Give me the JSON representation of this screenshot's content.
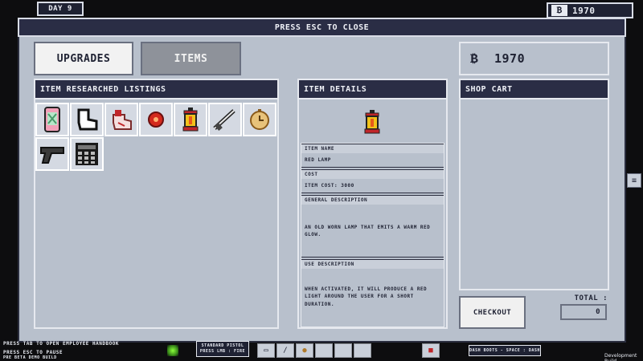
{
  "hud": {
    "day": "DAY 9",
    "money": "1970",
    "currency_symbol": "₿"
  },
  "window": {
    "close_hint": "PRESS ESC TO CLOSE"
  },
  "tabs": [
    {
      "label": "UPGRADES",
      "active": true
    },
    {
      "label": "ITEMS",
      "active": false
    }
  ],
  "wallet": {
    "amount": "1970",
    "symbol": "₿"
  },
  "listings": {
    "title": "ITEM RESEARCHED LISTINGS",
    "items": [
      {
        "icon": "energy-can-icon"
      },
      {
        "icon": "sock-icon"
      },
      {
        "icon": "bandage-icon"
      },
      {
        "icon": "red-orb-icon"
      },
      {
        "icon": "red-lamp-icon"
      },
      {
        "icon": "rifle-icon"
      },
      {
        "icon": "pocket-watch-icon"
      },
      {
        "icon": "pistol-icon"
      },
      {
        "icon": "keypad-icon"
      }
    ]
  },
  "details": {
    "title": "ITEM DETAILS",
    "icon": "red-lamp-icon",
    "name_label": "ITEM NAME",
    "name_value": "RED LAMP",
    "cost_label": "COST",
    "cost_value": "ITEM COST: 3000",
    "general_label": "GENERAL DESCRIPTION",
    "general_value": "AN OLD WORN LAMP THAT EMITS A WARM RED GLOW.",
    "use_label": "USE DESCRIPTION",
    "use_value": "WHEN ACTIVATED, IT WILL PRODUCE A RED LIGHT AROUND THE USER FOR A SHORT DURATION."
  },
  "cart": {
    "title": "SHOP CART",
    "checkout_label": "CHECKOUT",
    "total_label": "TOTAL :",
    "total_value": "0"
  },
  "bottom": {
    "handbook_hint": "PRESS TAB TO OPEN EMPLOYEE HANDBOOK",
    "pause_hint": "PRESS ESC TO PAUSE",
    "build_tag": "PRE BETA DEMO BUILD",
    "weapon_name": "STANDARD PISTOL",
    "weapon_hint": "PRESS LMB : FIRE",
    "dash_hint": "DASH BOOTS - SPACE : DASH",
    "dev_build": "Development Build"
  },
  "colors": {
    "header": "#2a2d45",
    "panel": "#b8c0cc",
    "accent_red": "#c0262a",
    "lamp_yellow": "#f2c21a"
  }
}
